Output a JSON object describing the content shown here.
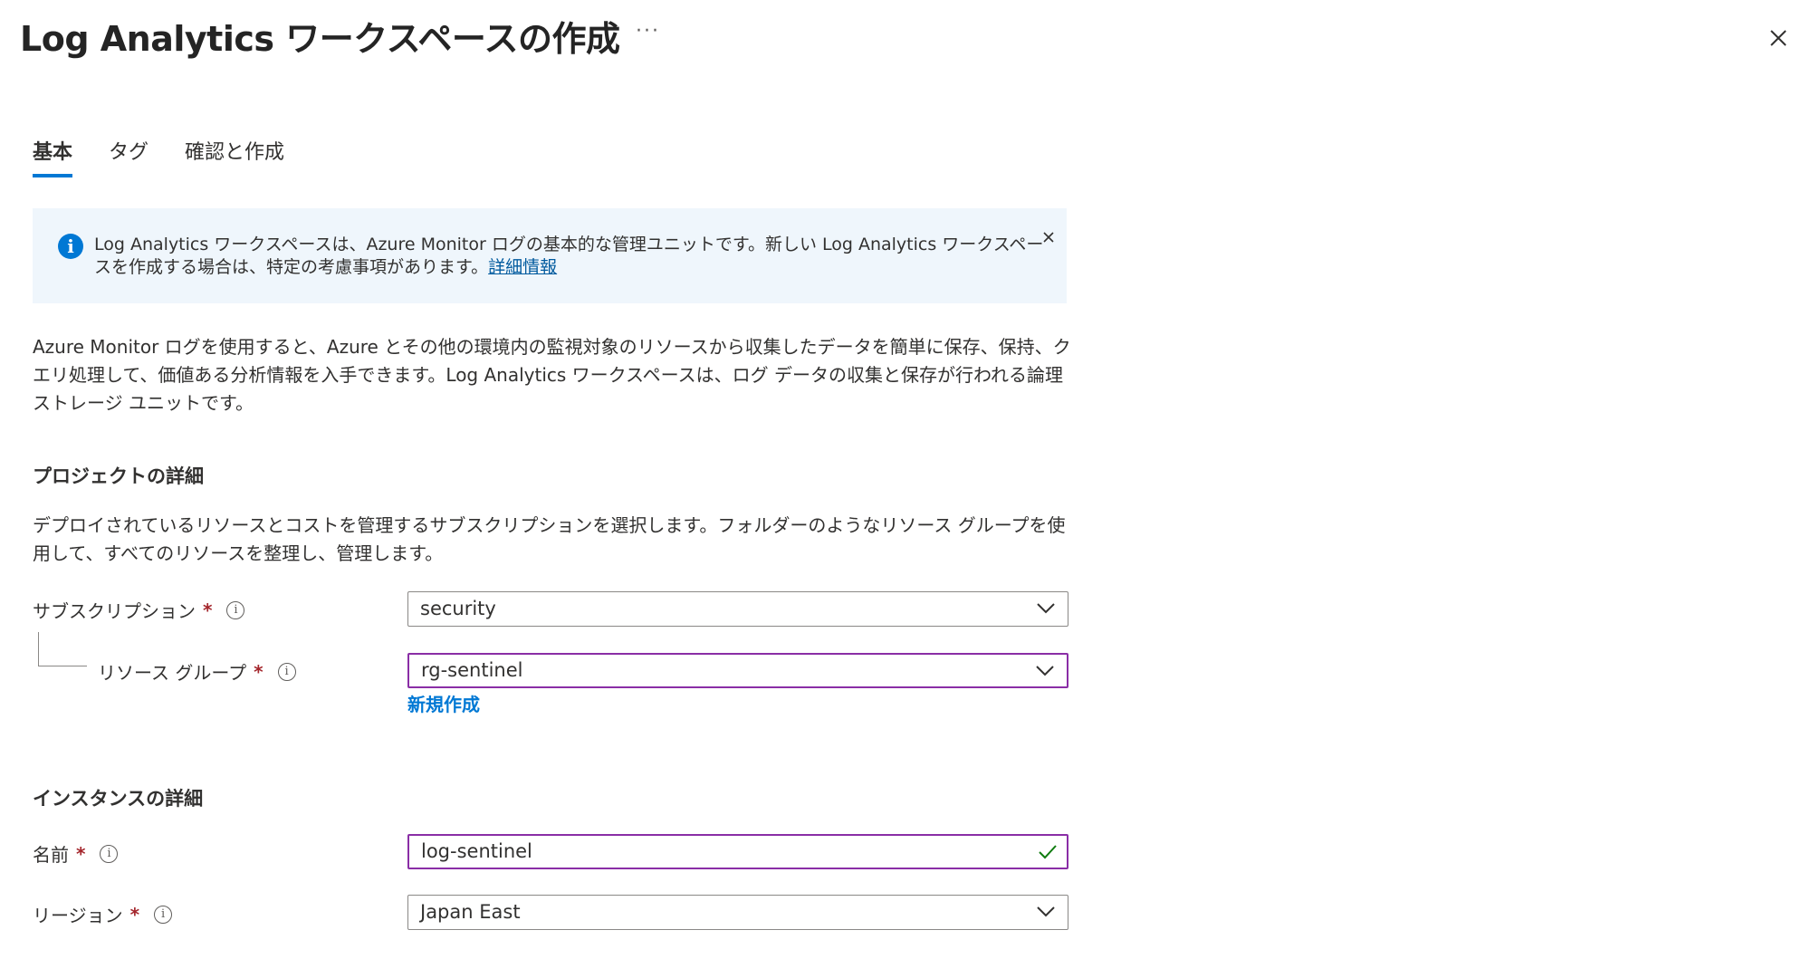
{
  "header": {
    "title": "Log Analytics ワークスペースの作成",
    "more_label": "···",
    "more_icon": "ellipsis-icon",
    "close_icon": "close-icon"
  },
  "tabs": [
    {
      "label": "基本",
      "active": true
    },
    {
      "label": "タグ",
      "active": false
    },
    {
      "label": "確認と作成",
      "active": false
    }
  ],
  "banner": {
    "icon": "info-icon",
    "icon_glyph": "i",
    "text": "Log Analytics ワークスペースは、Azure Monitor ログの基本的な管理ユニットです。新しい Log Analytics ワークスペースを作成する場合は、特定の考慮事項があります。",
    "link": "詳細情報",
    "dismiss_icon": "close-icon"
  },
  "description": "Azure Monitor ログを使用すると、Azure とその他の環境内の監視対象のリソースから収集したデータを簡単に保存、保持、クエリ処理して、価値ある分析情報を入手できます。Log Analytics ワークスペースは、ログ データの収集と保存が行われる論理ストレージ ユニットです。",
  "project": {
    "title": "プロジェクトの詳細",
    "description": "デプロイされているリソースとコストを管理するサブスクリプションを選択します。フォルダーのようなリソース グループを使用して、すべてのリソースを整理し、管理します。",
    "subscription": {
      "label": "サブスクリプション",
      "required": "*",
      "tip": "i",
      "value": "security"
    },
    "resource_group": {
      "label": "リソース グループ",
      "required": "*",
      "tip": "i",
      "value": "rg-sentinel"
    },
    "new_link": "新規作成"
  },
  "instance": {
    "title": "インスタンスの詳細",
    "name": {
      "label": "名前",
      "required": "*",
      "tip": "i",
      "value": "log-sentinel"
    },
    "region": {
      "label": "リージョン",
      "required": "*",
      "tip": "i",
      "value": "Japan East"
    }
  },
  "colors": {
    "accent": "#0078d4",
    "focus_border": "#8a2ea6",
    "required": "#a4262c",
    "valid_check": "#107c10",
    "banner_bg": "#eff6fc"
  }
}
